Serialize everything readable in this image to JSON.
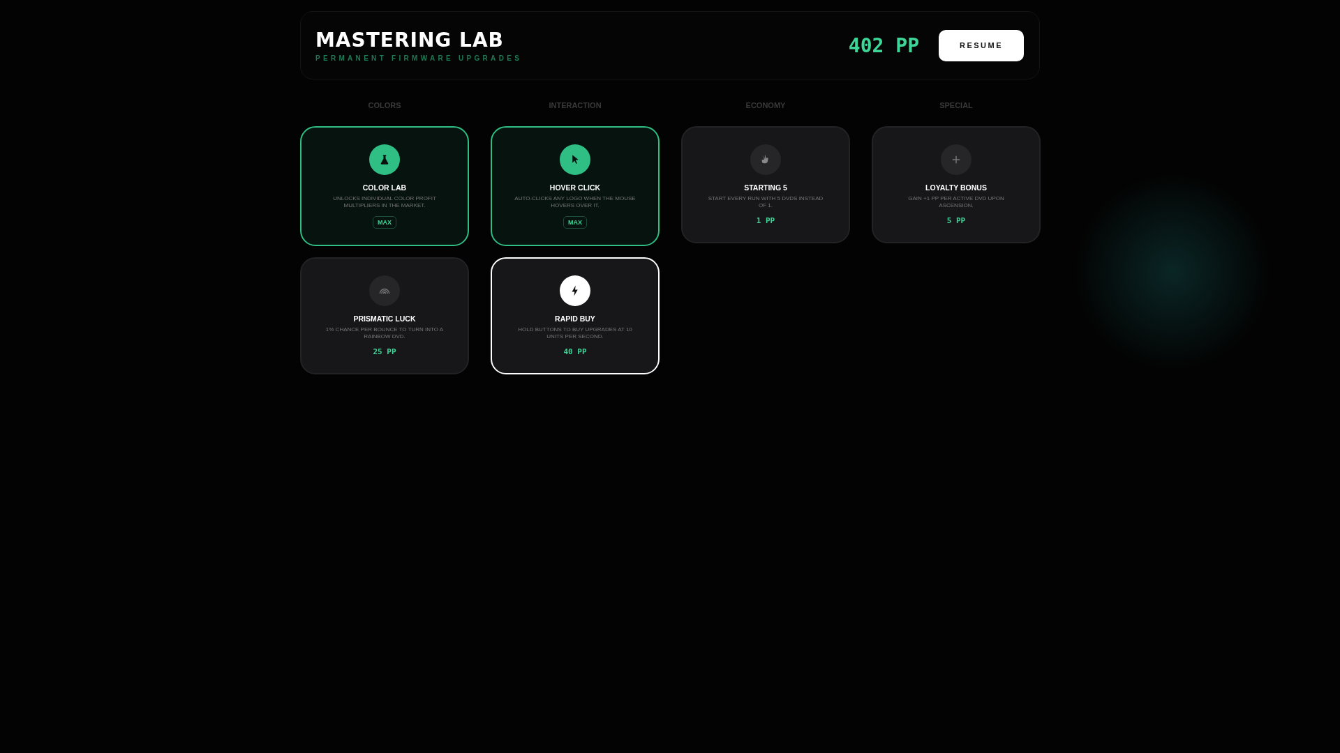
{
  "header": {
    "title": "MASTERING LAB",
    "subtitle": "PERMANENT FIRMWARE UPGRADES",
    "points": "402 PP",
    "resume_button": "RESUME"
  },
  "categories": [
    {
      "label": "COLORS",
      "upgrades": [
        {
          "name": "COLOR LAB",
          "description": "UNLOCKS INDIVIDUAL COLOR PROFIT MULTIPLIERS IN THE MARKET.",
          "maxed": true,
          "badge": "MAX",
          "highlighted": false
        },
        {
          "name": "PRISMATIC LUCK",
          "description": "1% CHANCE PER BOUNCE TO TURN INTO A RAINBOW DVD.",
          "maxed": false,
          "price": "25 PP",
          "highlighted": false
        }
      ]
    },
    {
      "label": "INTERACTION",
      "upgrades": [
        {
          "name": "HOVER CLICK",
          "description": "AUTO-CLICKS ANY LOGO WHEN THE MOUSE HOVERS OVER IT.",
          "maxed": true,
          "badge": "MAX",
          "highlighted": false
        },
        {
          "name": "RAPID BUY",
          "description": "HOLD BUTTONS TO BUY UPGRADES AT 10 UNITS PER SECOND.",
          "maxed": false,
          "price": "40 PP",
          "highlighted": true
        }
      ]
    },
    {
      "label": "ECONOMY",
      "upgrades": [
        {
          "name": "STARTING 5",
          "description": "START EVERY RUN WITH 5 DVDS INSTEAD OF 1.",
          "maxed": false,
          "price": "1 PP",
          "highlighted": false
        }
      ]
    },
    {
      "label": "SPECIAL",
      "upgrades": [
        {
          "name": "LOYALTY BONUS",
          "description": "GAIN +1 PP PER ACTIVE DVD UPON ASCENSION.",
          "maxed": false,
          "price": "5 PP",
          "highlighted": false
        }
      ]
    }
  ]
}
